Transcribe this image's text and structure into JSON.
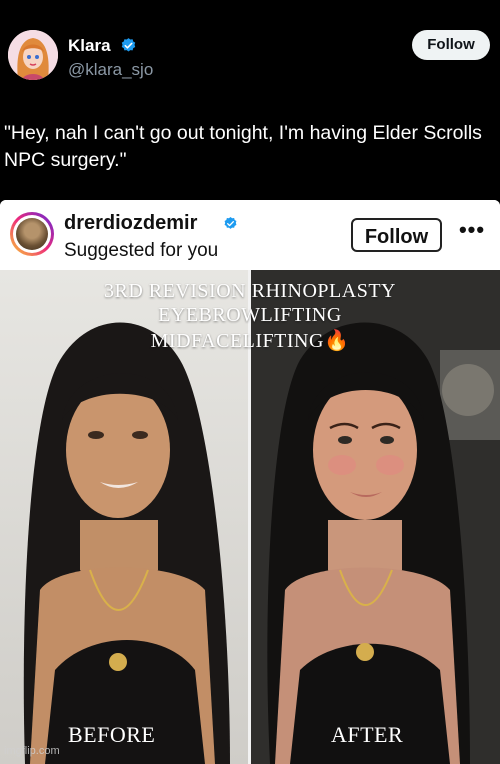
{
  "tweet": {
    "author_name": "Klara",
    "author_handle": "@klara_sjo",
    "follow_label": "Follow",
    "text": "\"Hey, nah I can't go out tonight, I'm having Elder Scrolls NPC surgery.\""
  },
  "embedded_post": {
    "username": "drerdiozdemir",
    "subtitle": "Suggested for you",
    "follow_label": "Follow",
    "more_label": "•••",
    "overlay_lines": [
      "3RD REVISION RHINOPLASTY",
      "EYEBROWLIFTING",
      "MIDFACELIFTING"
    ],
    "overlay_emoji": "🔥",
    "before_label": "BEFORE",
    "after_label": "AFTER"
  },
  "watermark": "imgflip.com",
  "icons": {
    "verified": "verified-badge-icon",
    "more": "more-options-icon"
  },
  "colors": {
    "background": "#000000",
    "verified_blue": "#1d9bf0",
    "follow_button_bg": "#eff3f4",
    "handle_gray": "#8b98a5"
  }
}
